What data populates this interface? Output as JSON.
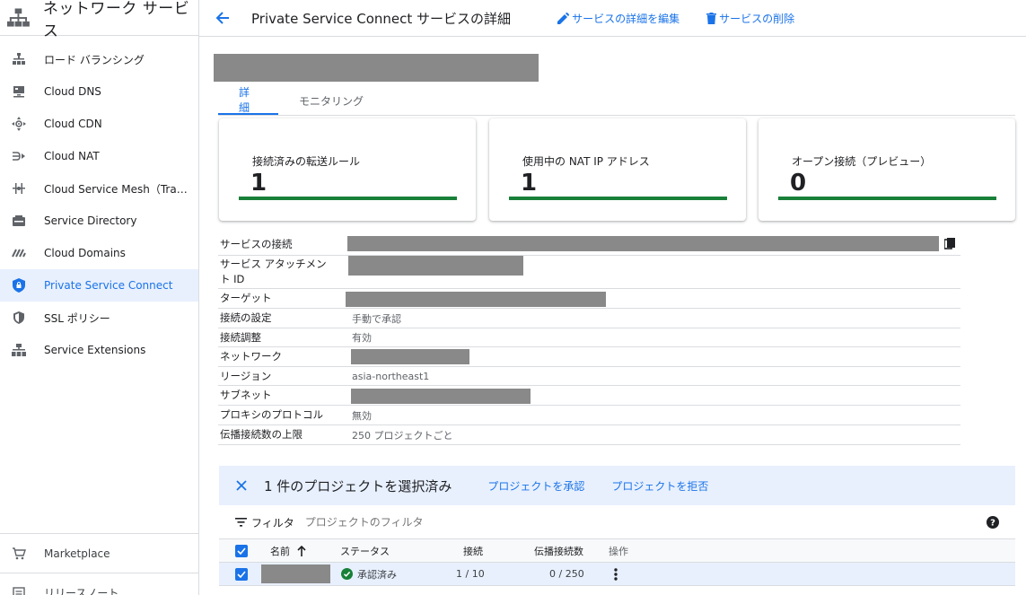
{
  "sidebar": {
    "title": "ネットワーク サービス",
    "items": [
      {
        "label": "ロード バランシング",
        "icon": "load-balancing-icon"
      },
      {
        "label": "Cloud DNS",
        "icon": "dns-icon"
      },
      {
        "label": "Cloud CDN",
        "icon": "cdn-icon"
      },
      {
        "label": "Cloud NAT",
        "icon": "nat-icon"
      },
      {
        "label": "Cloud Service Mesh（Traffic Director）",
        "icon": "service-mesh-icon"
      },
      {
        "label": "Service Directory",
        "icon": "service-directory-icon"
      },
      {
        "label": "Cloud Domains",
        "icon": "domains-icon"
      },
      {
        "label": "Private Service Connect",
        "icon": "shield-lock-icon"
      },
      {
        "label": "SSL ポリシー",
        "icon": "shield-icon"
      },
      {
        "label": "Service Extensions",
        "icon": "extensions-icon"
      }
    ],
    "bottom": [
      {
        "label": "Marketplace",
        "icon": "cart-icon"
      },
      {
        "label": "リリースノート",
        "icon": "notes-icon"
      }
    ]
  },
  "header": {
    "title": "Private Service Connect サービスの詳細",
    "edit_label": "サービスの詳細を編集",
    "delete_label": "サービスの削除"
  },
  "tabs": [
    "詳細",
    "モニタリング"
  ],
  "cards": [
    {
      "label": "接続済みの転送ルール",
      "value": "1"
    },
    {
      "label": "使用中の NAT IP アドレス",
      "value": "1"
    },
    {
      "label": "オープン接続（プレビュー）",
      "value": "0"
    }
  ],
  "details": {
    "service_connection": "サービスの接続",
    "attachment_id": "サービス アタッチメント ID",
    "target": "ターゲット",
    "conn_pref": "接続の設定",
    "conn_pref_val": "手動で承認",
    "conn_adj": "接続調整",
    "conn_adj_val": "有効",
    "network": "ネットワーク",
    "region": "リージョン",
    "region_val": "asia-northeast1",
    "subnet": "サブネット",
    "proxy_protocol": "プロキシのプロトコル",
    "proxy_protocol_val": "無効",
    "propagated_limit": "伝播接続数の上限",
    "propagated_limit_val": "250 プロジェクトごと"
  },
  "selection": {
    "text": "1 件のプロジェクトを選択済み",
    "approve": "プロジェクトを承認",
    "reject": "プロジェクトを拒否"
  },
  "filter": {
    "label": "フィルタ",
    "placeholder": "プロジェクトのフィルタ"
  },
  "table": {
    "columns": {
      "name": "名前",
      "status": "ステータス",
      "connections": "接続",
      "propagated": "伝播接続数",
      "actions": "操作"
    },
    "rows": [
      {
        "status": "承認済み",
        "connections": "1 / 10",
        "propagated": "0 / 250"
      }
    ]
  },
  "colors": {
    "accent": "#1a73e8",
    "success": "#188038",
    "selection_bg": "#e8f0fe"
  }
}
